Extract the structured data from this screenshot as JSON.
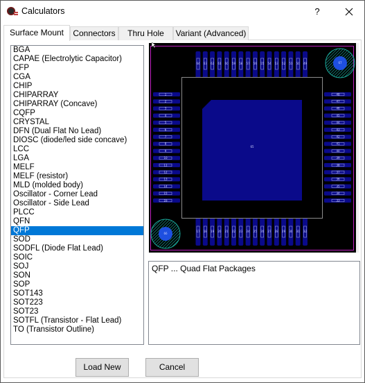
{
  "window": {
    "title": "Calculators",
    "help_label": "?",
    "close_label": "✕",
    "icon": "calculator-app-icon"
  },
  "tabs": [
    {
      "label": "Surface Mount",
      "active": true
    },
    {
      "label": "Connectors",
      "active": false
    },
    {
      "label": "Thru Hole",
      "active": false
    },
    {
      "label": "Variant (Advanced)",
      "active": false
    }
  ],
  "package_list": {
    "selected": "QFP",
    "items": [
      "BGA",
      "CAPAE (Electrolytic Capacitor)",
      "CFP",
      "CGA",
      "CHIP",
      "CHIPARRAY",
      "CHIPARRAY (Concave)",
      "CQFP",
      "CRYSTAL",
      "DFN (Dual Flat No Lead)",
      "DIOSC (diode/led side concave)",
      "LCC",
      "LGA",
      "MELF",
      "MELF (resistor)",
      "MLD (molded body)",
      "Oscillator - Corner Lead",
      "Oscillator - Side Lead",
      "PLCC",
      "QFN",
      "QFP",
      "SOD",
      "SODFL (Diode Flat Lead)",
      "SOIC",
      "SOJ",
      "SON",
      "SOP",
      "SOT143",
      "SOT223",
      "SOT23",
      "SOTFL (Transistor - Flat Lead)",
      "TO (Transistor Outline)"
    ]
  },
  "preview": {
    "pins_left": [
      "1",
      "2",
      "3",
      "4",
      "5",
      "6",
      "7",
      "8",
      "9",
      "10",
      "11",
      "12",
      "13",
      "14",
      "15",
      "16"
    ],
    "pins_bottom": [
      "17",
      "18",
      "19",
      "20",
      "21",
      "22",
      "23",
      "24",
      "25",
      "26",
      "27",
      "28",
      "29",
      "30",
      "31",
      "32"
    ],
    "pins_right": [
      "48",
      "47",
      "46",
      "45",
      "44",
      "43",
      "42",
      "41",
      "40",
      "39",
      "38",
      "37",
      "36",
      "35",
      "34",
      "33"
    ],
    "pins_top": [
      "64",
      "63",
      "62",
      "61",
      "60",
      "59",
      "58",
      "57",
      "56",
      "55",
      "54",
      "53",
      "52",
      "51",
      "50",
      "49"
    ],
    "center_pad_label": "65",
    "fiducial_top_right": "67",
    "fiducial_bottom_left": "66",
    "colors": {
      "background": "#000000",
      "pad": "#0a0a8a",
      "pad_outline": "#9aa0d8",
      "body_outline": "#8c8c8c",
      "board_outline": "#c020c0",
      "fiducial_ring": "#1aa89a",
      "fiducial_core": "#1e4fe0"
    }
  },
  "description": {
    "text": "QFP ... Quad Flat Packages"
  },
  "buttons": {
    "load_new": "Load New",
    "cancel": "Cancel"
  }
}
